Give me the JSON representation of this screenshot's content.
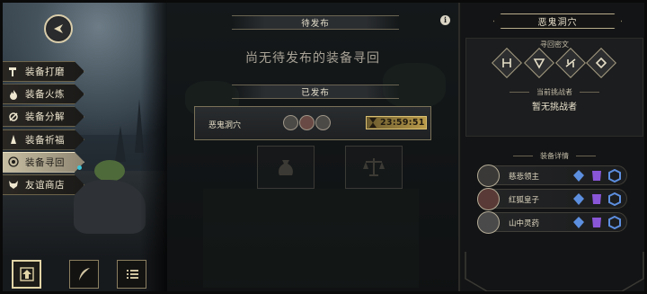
{
  "menu": {
    "items": [
      {
        "label": "装备打磨",
        "icon": "hammer-icon"
      },
      {
        "label": "装备火炼",
        "icon": "flame-icon"
      },
      {
        "label": "装备分解",
        "icon": "scatter-icon"
      },
      {
        "label": "装备祈福",
        "icon": "pray-icon"
      },
      {
        "label": "装备寻回",
        "icon": "target-icon",
        "active": true
      },
      {
        "label": "友谊商店",
        "icon": "fox-icon"
      }
    ]
  },
  "bottom_buttons": [
    {
      "icon": "upload-arrow-icon",
      "selected": true
    },
    {
      "icon": "feather-icon",
      "selected": false
    },
    {
      "icon": "list-icon",
      "selected": false
    }
  ],
  "middle": {
    "pending_header": "待发布",
    "empty_message": "尚无待发布的装备寻回",
    "published_header": "已发布",
    "published_quest": {
      "name": "恶鬼洞穴",
      "timer": "23:59:51"
    }
  },
  "right": {
    "title": "恶鬼洞穴",
    "rune_caption": "寻回密文",
    "challenger_caption": "当前挑战者",
    "challenger_value": "暂无挑战者",
    "details_caption": "装备详情",
    "equipment": [
      {
        "name": "慈悲领主"
      },
      {
        "name": "红狐皇子"
      },
      {
        "name": "山中灵药"
      }
    ]
  },
  "colors": {
    "accent_gold": "#d9bf72",
    "gem_blue": "#5d8fe0",
    "gem_purple": "#8a56d8",
    "menu_dot": "#3ec6d8"
  }
}
